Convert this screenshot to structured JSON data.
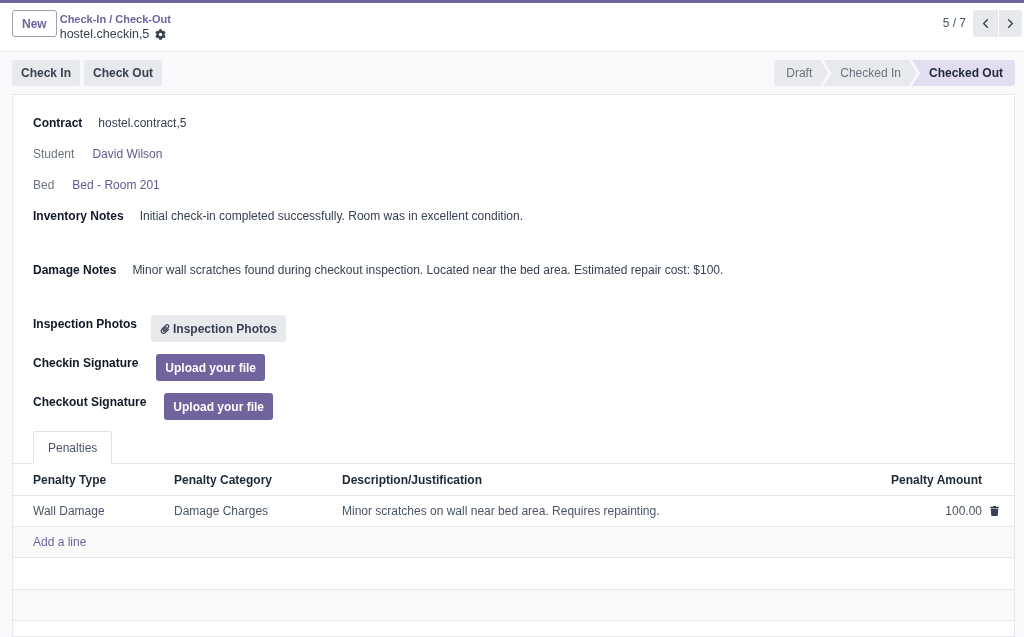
{
  "control_panel": {
    "new_button": "New",
    "breadcrumb": "Check-In / Check-Out",
    "record_name": "hostel.checkin,5",
    "pager": "5 / 7"
  },
  "action_buttons": [
    "Check In",
    "Check Out"
  ],
  "statusbar": [
    {
      "label": "Draft",
      "selected": false
    },
    {
      "label": "Checked In",
      "selected": false
    },
    {
      "label": "Checked Out",
      "selected": true
    }
  ],
  "fields": [
    {
      "label": "Contract",
      "readonly": false,
      "kind": "text",
      "value": "hostel.contract,5"
    },
    {
      "label": "Student",
      "readonly": true,
      "kind": "link",
      "value": "David Wilson"
    },
    {
      "label": "Bed",
      "readonly": true,
      "kind": "link",
      "value": "Bed - Room 201"
    },
    {
      "label": "Inventory Notes",
      "readonly": false,
      "kind": "notes",
      "value": "Initial check-in completed successfully. Room was in excellent condition."
    },
    {
      "label": "Damage Notes",
      "readonly": false,
      "kind": "notes",
      "value": "Minor wall scratches found during checkout inspection. Located near the bed area. Estimated repair cost: $100."
    },
    {
      "label": "Inspection Photos",
      "readonly": false,
      "kind": "attachment",
      "value": "Inspection Photos"
    },
    {
      "label": "Checkin Signature",
      "readonly": false,
      "kind": "upload",
      "value": "Upload your file"
    },
    {
      "label": "Checkout Signature",
      "readonly": false,
      "kind": "upload",
      "value": "Upload your file"
    }
  ],
  "tabs": [
    {
      "label": "Penalties",
      "selected": true
    }
  ],
  "penalties": {
    "columns": [
      "Penalty Type",
      "Penalty Category",
      "Description/Justification",
      "Penalty Amount"
    ],
    "rows": [
      {
        "cells": [
          "Wall Damage",
          "Damage Charges",
          "Minor scratches on wall near bed area. Requires repainting.",
          "100.00"
        ]
      }
    ],
    "add_line": "Add a line"
  }
}
